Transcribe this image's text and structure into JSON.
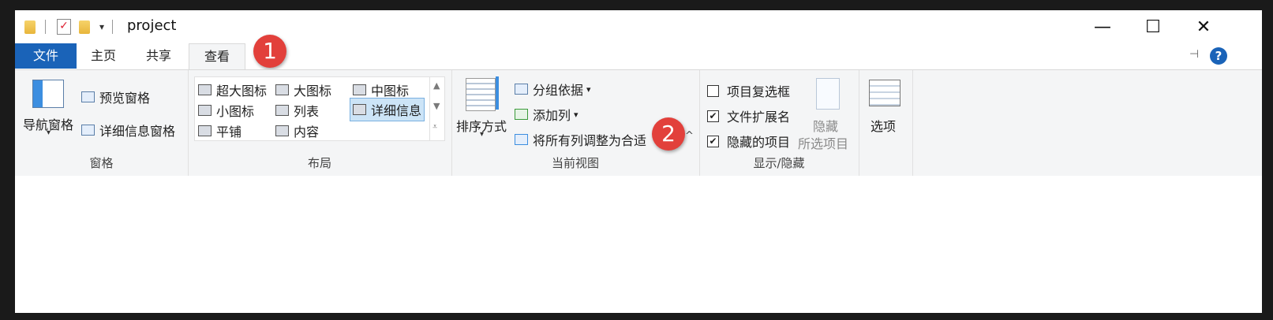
{
  "window": {
    "title": "project",
    "minimize": "—",
    "maximize": "☐",
    "close": "✕"
  },
  "tabs": {
    "file": "文件",
    "home": "主页",
    "share": "共享",
    "view": "查看"
  },
  "badges": {
    "one": "1",
    "two": "2"
  },
  "ribbon": {
    "panes": {
      "label": "窗格",
      "nav_pane": "导航窗格",
      "preview_pane": "预览窗格",
      "details_pane": "详细信息窗格"
    },
    "layout": {
      "label": "布局",
      "items": [
        "超大图标",
        "大图标",
        "中图标",
        "小图标",
        "列表",
        "详细信息",
        "平铺",
        "内容"
      ],
      "selected": "详细信息"
    },
    "current_view": {
      "label": "当前视图",
      "sort_by": "排序方式",
      "group_by": "分组依据",
      "add_columns": "添加列",
      "size_columns": "将所有列调整为合适"
    },
    "show_hide": {
      "label": "显示/隐藏",
      "item_checkboxes": "项目复选框",
      "file_extensions": "文件扩展名",
      "hidden_items": "隐藏的项目",
      "hide_selected": "隐藏",
      "hide_selected_2": "所选项目",
      "checks": {
        "item_checkboxes": false,
        "file_extensions": true,
        "hidden_items": true
      }
    },
    "options": {
      "label": "选项"
    }
  },
  "help": "?"
}
